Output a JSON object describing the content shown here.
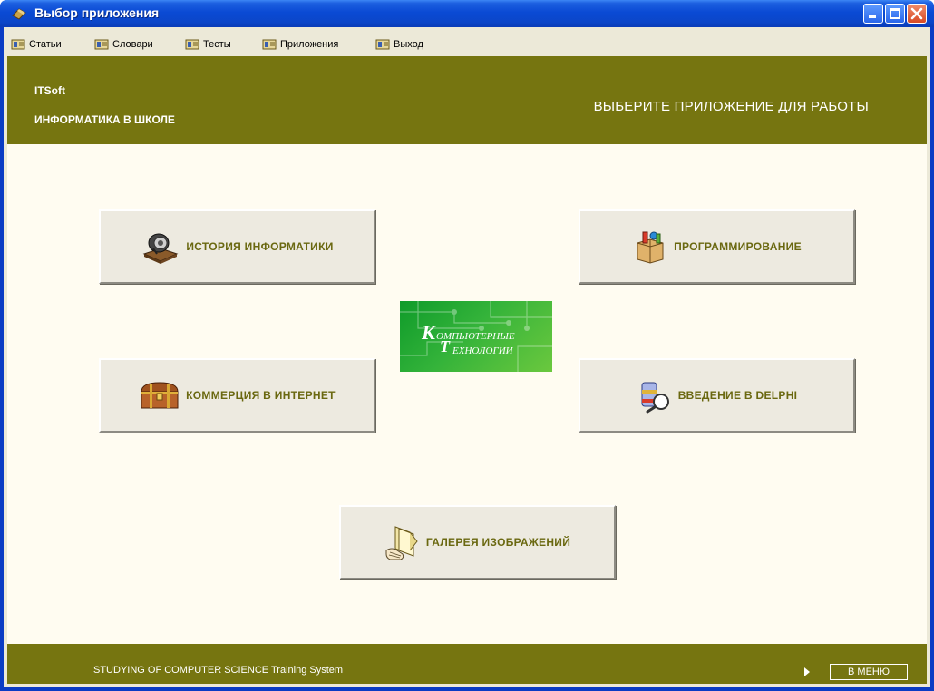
{
  "window": {
    "title": "Выбор приложения"
  },
  "menu": {
    "items": [
      {
        "label": "Статьи"
      },
      {
        "label": "Словари"
      },
      {
        "label": "Тесты"
      },
      {
        "label": "Приложения"
      },
      {
        "label": "Выход"
      }
    ]
  },
  "header": {
    "brand": "ITSoft",
    "subtitle": "ИНФОРМАТИКА В ШКОЛЕ",
    "prompt": "ВЫБЕРИТЕ ПРИЛОЖЕНИЕ ДЛЯ РАБОТЫ"
  },
  "apps": {
    "history": "ИСТОРИЯ ИНФОРМАТИКИ",
    "programming": "ПРОГРАММИРОВАНИЕ",
    "commerce": "КОММЕРЦИЯ В ИНТЕРНЕТ",
    "delphi": "ВВЕДЕНИЕ В DELPHI",
    "gallery": "ГАЛЕРЕЯ ИЗОБРАЖЕНИЙ"
  },
  "logo": {
    "line1_initial": "К",
    "line1_rest": "ОМПЬЮТЕРНЫЕ",
    "line2_initial": "Т",
    "line2_rest": "ЕХНОЛОГИИ"
  },
  "footer": {
    "status": "STUDYING OF COMPUTER SCIENCE Training System",
    "menu_button": "В МЕНЮ"
  },
  "colors": {
    "olive": "#767510",
    "button_text": "#6a6810",
    "xp_blue": "#0a4ad4"
  }
}
